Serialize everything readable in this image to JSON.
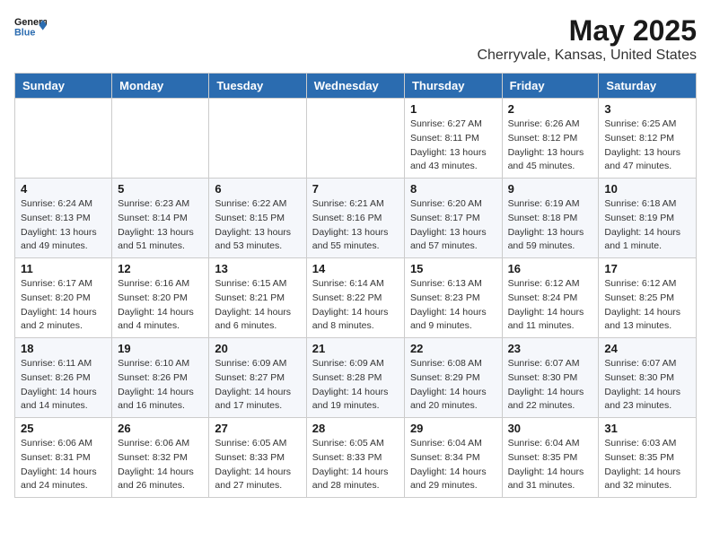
{
  "header": {
    "logo_general": "General",
    "logo_blue": "Blue",
    "title": "May 2025",
    "subtitle": "Cherryvale, Kansas, United States"
  },
  "days_of_week": [
    "Sunday",
    "Monday",
    "Tuesday",
    "Wednesday",
    "Thursday",
    "Friday",
    "Saturday"
  ],
  "weeks": [
    [
      {
        "day": "",
        "detail": ""
      },
      {
        "day": "",
        "detail": ""
      },
      {
        "day": "",
        "detail": ""
      },
      {
        "day": "",
        "detail": ""
      },
      {
        "day": "1",
        "detail": "Sunrise: 6:27 AM\nSunset: 8:11 PM\nDaylight: 13 hours\nand 43 minutes."
      },
      {
        "day": "2",
        "detail": "Sunrise: 6:26 AM\nSunset: 8:12 PM\nDaylight: 13 hours\nand 45 minutes."
      },
      {
        "day": "3",
        "detail": "Sunrise: 6:25 AM\nSunset: 8:12 PM\nDaylight: 13 hours\nand 47 minutes."
      }
    ],
    [
      {
        "day": "4",
        "detail": "Sunrise: 6:24 AM\nSunset: 8:13 PM\nDaylight: 13 hours\nand 49 minutes."
      },
      {
        "day": "5",
        "detail": "Sunrise: 6:23 AM\nSunset: 8:14 PM\nDaylight: 13 hours\nand 51 minutes."
      },
      {
        "day": "6",
        "detail": "Sunrise: 6:22 AM\nSunset: 8:15 PM\nDaylight: 13 hours\nand 53 minutes."
      },
      {
        "day": "7",
        "detail": "Sunrise: 6:21 AM\nSunset: 8:16 PM\nDaylight: 13 hours\nand 55 minutes."
      },
      {
        "day": "8",
        "detail": "Sunrise: 6:20 AM\nSunset: 8:17 PM\nDaylight: 13 hours\nand 57 minutes."
      },
      {
        "day": "9",
        "detail": "Sunrise: 6:19 AM\nSunset: 8:18 PM\nDaylight: 13 hours\nand 59 minutes."
      },
      {
        "day": "10",
        "detail": "Sunrise: 6:18 AM\nSunset: 8:19 PM\nDaylight: 14 hours\nand 1 minute."
      }
    ],
    [
      {
        "day": "11",
        "detail": "Sunrise: 6:17 AM\nSunset: 8:20 PM\nDaylight: 14 hours\nand 2 minutes."
      },
      {
        "day": "12",
        "detail": "Sunrise: 6:16 AM\nSunset: 8:20 PM\nDaylight: 14 hours\nand 4 minutes."
      },
      {
        "day": "13",
        "detail": "Sunrise: 6:15 AM\nSunset: 8:21 PM\nDaylight: 14 hours\nand 6 minutes."
      },
      {
        "day": "14",
        "detail": "Sunrise: 6:14 AM\nSunset: 8:22 PM\nDaylight: 14 hours\nand 8 minutes."
      },
      {
        "day": "15",
        "detail": "Sunrise: 6:13 AM\nSunset: 8:23 PM\nDaylight: 14 hours\nand 9 minutes."
      },
      {
        "day": "16",
        "detail": "Sunrise: 6:12 AM\nSunset: 8:24 PM\nDaylight: 14 hours\nand 11 minutes."
      },
      {
        "day": "17",
        "detail": "Sunrise: 6:12 AM\nSunset: 8:25 PM\nDaylight: 14 hours\nand 13 minutes."
      }
    ],
    [
      {
        "day": "18",
        "detail": "Sunrise: 6:11 AM\nSunset: 8:26 PM\nDaylight: 14 hours\nand 14 minutes."
      },
      {
        "day": "19",
        "detail": "Sunrise: 6:10 AM\nSunset: 8:26 PM\nDaylight: 14 hours\nand 16 minutes."
      },
      {
        "day": "20",
        "detail": "Sunrise: 6:09 AM\nSunset: 8:27 PM\nDaylight: 14 hours\nand 17 minutes."
      },
      {
        "day": "21",
        "detail": "Sunrise: 6:09 AM\nSunset: 8:28 PM\nDaylight: 14 hours\nand 19 minutes."
      },
      {
        "day": "22",
        "detail": "Sunrise: 6:08 AM\nSunset: 8:29 PM\nDaylight: 14 hours\nand 20 minutes."
      },
      {
        "day": "23",
        "detail": "Sunrise: 6:07 AM\nSunset: 8:30 PM\nDaylight: 14 hours\nand 22 minutes."
      },
      {
        "day": "24",
        "detail": "Sunrise: 6:07 AM\nSunset: 8:30 PM\nDaylight: 14 hours\nand 23 minutes."
      }
    ],
    [
      {
        "day": "25",
        "detail": "Sunrise: 6:06 AM\nSunset: 8:31 PM\nDaylight: 14 hours\nand 24 minutes."
      },
      {
        "day": "26",
        "detail": "Sunrise: 6:06 AM\nSunset: 8:32 PM\nDaylight: 14 hours\nand 26 minutes."
      },
      {
        "day": "27",
        "detail": "Sunrise: 6:05 AM\nSunset: 8:33 PM\nDaylight: 14 hours\nand 27 minutes."
      },
      {
        "day": "28",
        "detail": "Sunrise: 6:05 AM\nSunset: 8:33 PM\nDaylight: 14 hours\nand 28 minutes."
      },
      {
        "day": "29",
        "detail": "Sunrise: 6:04 AM\nSunset: 8:34 PM\nDaylight: 14 hours\nand 29 minutes."
      },
      {
        "day": "30",
        "detail": "Sunrise: 6:04 AM\nSunset: 8:35 PM\nDaylight: 14 hours\nand 31 minutes."
      },
      {
        "day": "31",
        "detail": "Sunrise: 6:03 AM\nSunset: 8:35 PM\nDaylight: 14 hours\nand 32 minutes."
      }
    ]
  ]
}
